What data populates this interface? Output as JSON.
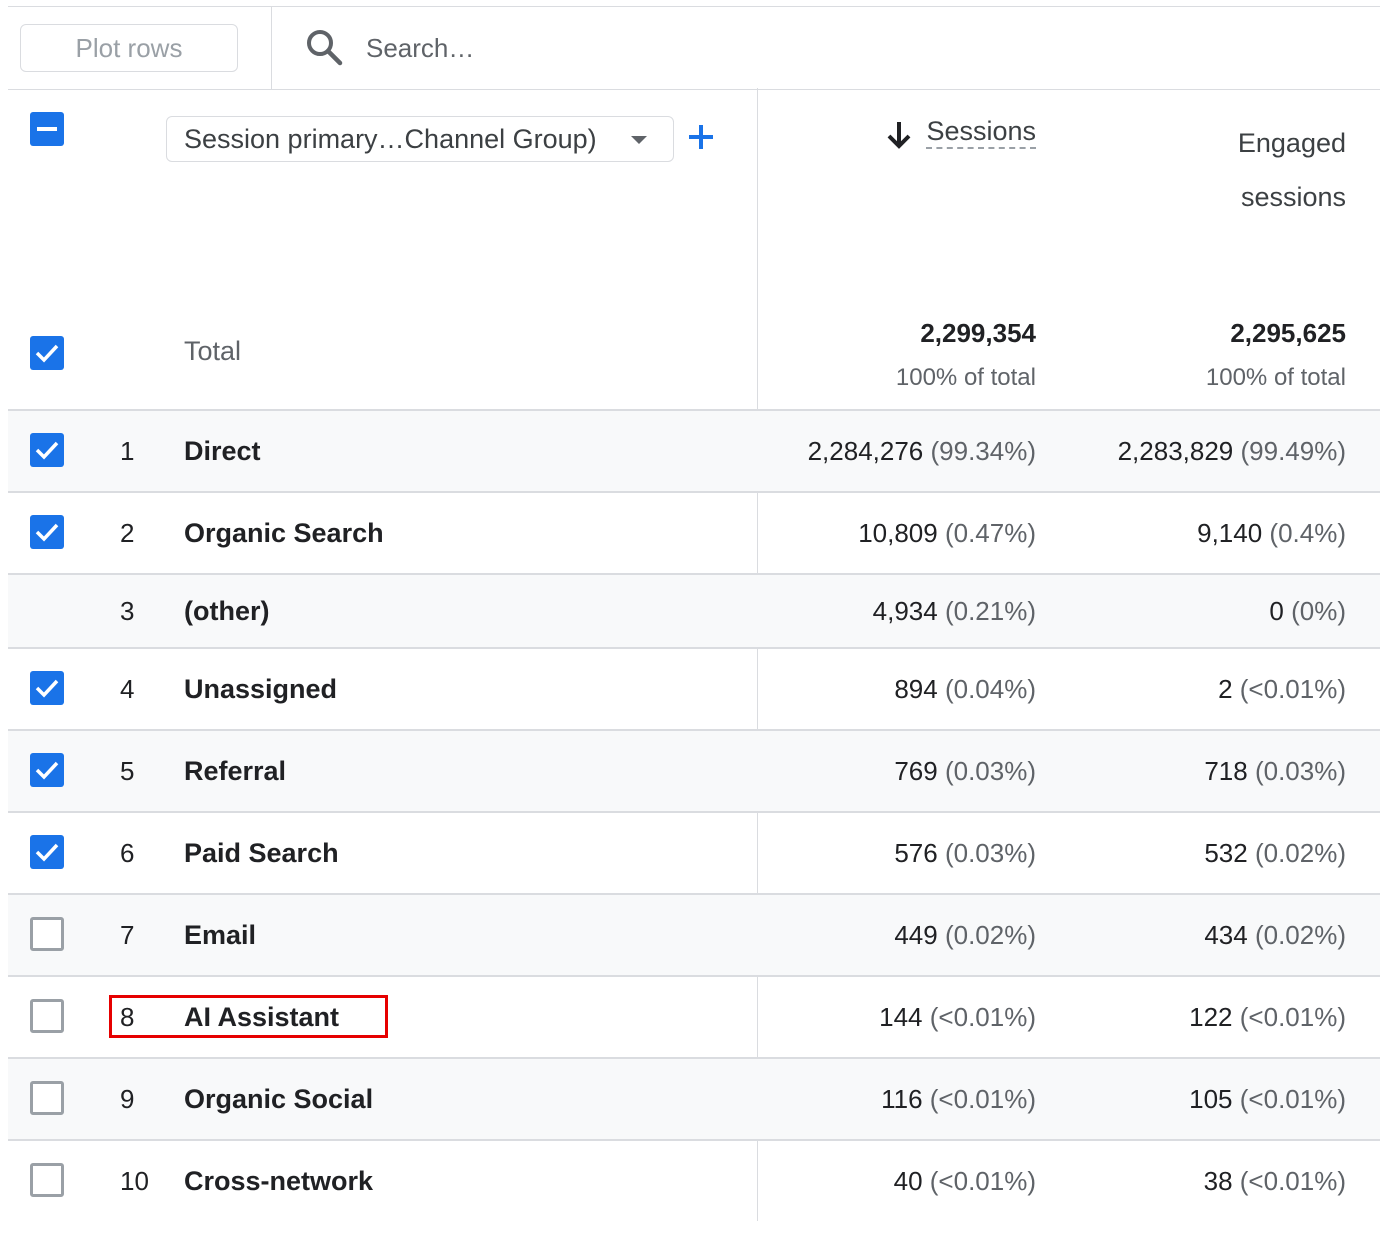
{
  "toolbar": {
    "plot_rows_label": "Plot rows",
    "search_placeholder": "Search…"
  },
  "header": {
    "dimension_select": "Session primary…Channel Group)",
    "sessions_label": "Sessions",
    "engaged_line1": "Engaged",
    "engaged_line2": "sessions"
  },
  "total": {
    "label": "Total",
    "sessions": "2,299,354",
    "sessions_pct": "100% of total",
    "engaged": "2,295,625",
    "engaged_pct": "100% of total"
  },
  "rows": [
    {
      "index": "1",
      "name": "Direct",
      "checkbox": "checked",
      "sessions": "2,284,276",
      "sessions_pct": "(99.34%)",
      "engaged": "2,283,829",
      "engaged_pct": "(99.49%)"
    },
    {
      "index": "2",
      "name": "Organic Search",
      "checkbox": "checked",
      "sessions": "10,809",
      "sessions_pct": "(0.47%)",
      "engaged": "9,140",
      "engaged_pct": "(0.4%)"
    },
    {
      "index": "3",
      "name": "(other)",
      "checkbox": "none",
      "sessions": "4,934",
      "sessions_pct": "(0.21%)",
      "engaged": "0",
      "engaged_pct": "(0%)"
    },
    {
      "index": "4",
      "name": "Unassigned",
      "checkbox": "checked",
      "sessions": "894",
      "sessions_pct": "(0.04%)",
      "engaged": "2",
      "engaged_pct": "(<0.01%)"
    },
    {
      "index": "5",
      "name": "Referral",
      "checkbox": "checked",
      "sessions": "769",
      "sessions_pct": "(0.03%)",
      "engaged": "718",
      "engaged_pct": "(0.03%)"
    },
    {
      "index": "6",
      "name": "Paid Search",
      "checkbox": "checked",
      "sessions": "576",
      "sessions_pct": "(0.03%)",
      "engaged": "532",
      "engaged_pct": "(0.02%)"
    },
    {
      "index": "7",
      "name": "Email",
      "checkbox": "unchecked",
      "sessions": "449",
      "sessions_pct": "(0.02%)",
      "engaged": "434",
      "engaged_pct": "(0.02%)"
    },
    {
      "index": "8",
      "name": "AI Assistant",
      "checkbox": "unchecked",
      "sessions": "144",
      "sessions_pct": "(<0.01%)",
      "engaged": "122",
      "engaged_pct": "(<0.01%)"
    },
    {
      "index": "9",
      "name": "Organic Social",
      "checkbox": "unchecked",
      "sessions": "116",
      "sessions_pct": "(<0.01%)",
      "engaged": "105",
      "engaged_pct": "(<0.01%)"
    },
    {
      "index": "10",
      "name": "Cross-network",
      "checkbox": "unchecked",
      "sessions": "40",
      "sessions_pct": "(<0.01%)",
      "engaged": "38",
      "engaged_pct": "(<0.01%)"
    }
  ],
  "colors": {
    "accent": "#1a73e8",
    "highlight_box": "#e60000",
    "border": "#dadce0"
  },
  "icons": [
    "search-icon",
    "sort-descending-icon",
    "add-icon",
    "dropdown-arrow-icon",
    "checkmark-icon",
    "minus-icon"
  ]
}
